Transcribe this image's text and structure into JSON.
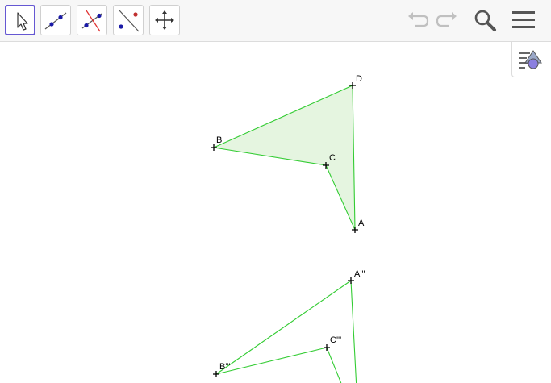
{
  "toolbar": {
    "tools": [
      {
        "name": "move-tool",
        "icon": "arrow-pointer-icon",
        "selected": true
      },
      {
        "name": "line-tool",
        "icon": "line-through-two-points-icon",
        "selected": false
      },
      {
        "name": "perpendicular-line-tool",
        "icon": "perpendicular-line-icon",
        "selected": false
      },
      {
        "name": "reflect-about-line-tool",
        "icon": "reflect-about-line-icon",
        "selected": false
      },
      {
        "name": "move-graphics-view-tool",
        "icon": "move-graphics-view-icon",
        "selected": false
      }
    ],
    "right_icons": [
      "undo-icon",
      "redo-icon",
      "search-icon",
      "menu-icon"
    ]
  },
  "algebra_toggle": {
    "icon": "algebra-view-toggle-icon"
  },
  "colors": {
    "accent": "#6557d2",
    "polygon_stroke": "#33cc33",
    "polygon_fill": "#e5f5e0",
    "point": "#000000",
    "icon_gray": "#666666",
    "disabled_gray": "#c0c0c0"
  },
  "graphics": {
    "points": [
      {
        "label": "D"
      },
      {
        "label": "B"
      },
      {
        "label": "C"
      },
      {
        "label": "A"
      },
      {
        "label": "A'''"
      },
      {
        "label": "C'''"
      },
      {
        "label": "B'''"
      }
    ]
  }
}
